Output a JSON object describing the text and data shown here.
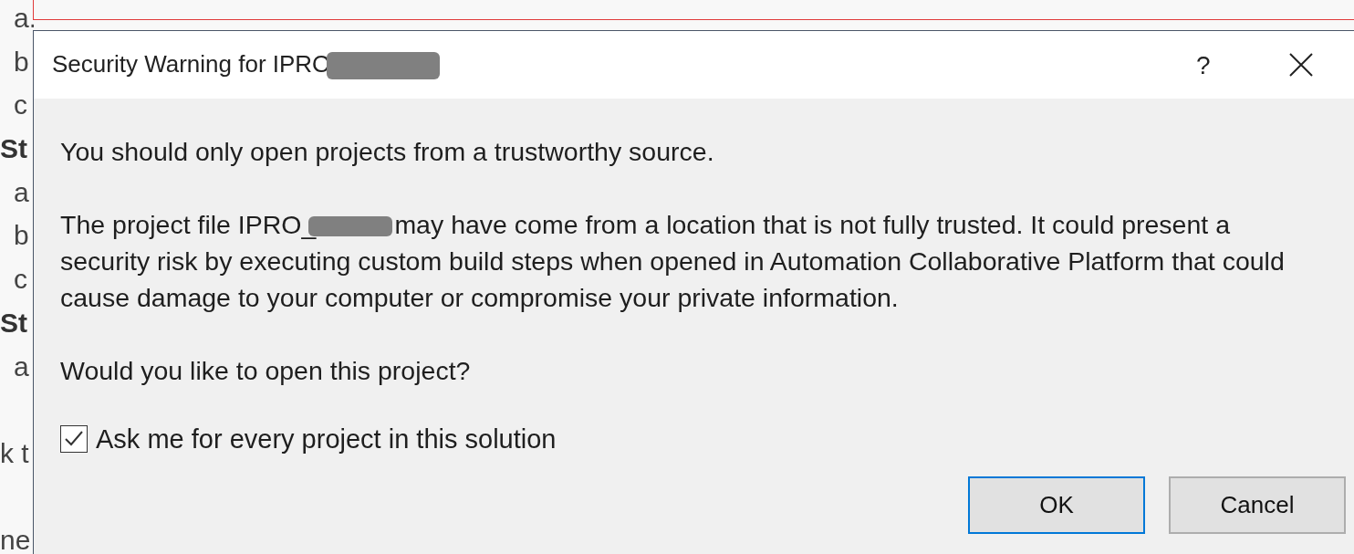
{
  "document": {
    "lines": [
      {
        "text": "a.",
        "kind": "item"
      },
      {
        "text": "b",
        "kind": "item"
      },
      {
        "text": "c",
        "kind": "item"
      },
      {
        "text": "St",
        "kind": "heading"
      },
      {
        "text": "a",
        "kind": "item"
      },
      {
        "text": "b",
        "kind": "item"
      },
      {
        "text": "c",
        "kind": "item"
      },
      {
        "text": "St",
        "kind": "heading"
      },
      {
        "text": "a",
        "kind": "item"
      },
      {
        "kind": "blank"
      },
      {
        "text": "k t",
        "kind": "plain"
      },
      {
        "kind": "blank"
      },
      {
        "text": "ne",
        "kind": "plain"
      }
    ]
  },
  "dialog": {
    "title": [
      {
        "kind": "text",
        "text": "Security Warning for IPRO"
      },
      {
        "kind": "redaction"
      }
    ],
    "help": "?",
    "paragraphs": [
      {
        "segments": [
          {
            "kind": "text",
            "text": "You should only open projects from a trustworthy source."
          }
        ]
      },
      {
        "segments": [
          {
            "kind": "text",
            "text": "The project file IPRO_"
          },
          {
            "kind": "redaction"
          },
          {
            "kind": "text",
            "text": "may have come from a location that is not fully trusted. It could present a security risk by executing custom build steps when opened in Automation Collaborative Platform that could cause damage to your computer or compromise your private information."
          }
        ]
      },
      {
        "segments": [
          {
            "kind": "text",
            "text": "Would you like to open this project?"
          }
        ]
      }
    ],
    "checkbox": {
      "label": "Ask me for every project in this solution",
      "checked": true
    },
    "buttons": [
      {
        "label": "OK",
        "default": true
      },
      {
        "label": "Cancel",
        "default": false
      }
    ]
  }
}
